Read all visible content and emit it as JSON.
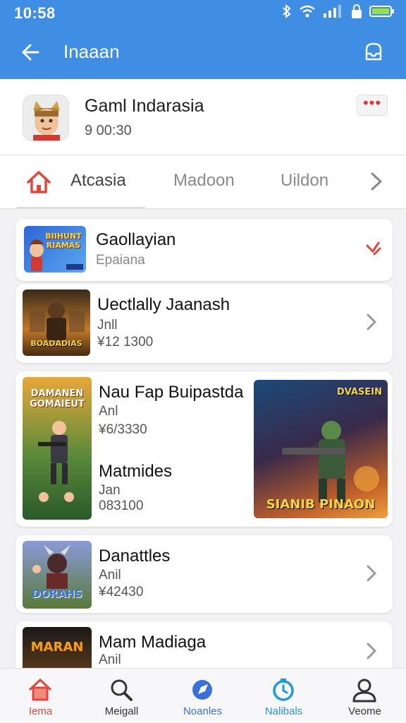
{
  "status": {
    "time": "10:58"
  },
  "header": {
    "title": "Inaaan"
  },
  "profile": {
    "name": "Gaml Indarasia",
    "subtitle": "9 00:30",
    "more": "•••"
  },
  "tabs": [
    {
      "label": "Atcasia"
    },
    {
      "label": "Madoon"
    },
    {
      "label": "Uildon"
    }
  ],
  "games": [
    {
      "title": "Gaollayian",
      "line1": "Epaiana",
      "thumb_text": "BIIHUNT RIAMAS"
    },
    {
      "title": "Uectlally Jaanash",
      "line1": "Jnll",
      "line2": "¥12 1300",
      "thumb_text": "BOADADIAS"
    },
    {
      "title": "Nau Fap Buipastda",
      "line1": "Anl",
      "line2": "¥6/3330",
      "title2": "Matmides",
      "line3": "Jan",
      "line4": "083100",
      "thumb_text": "DAMANEN GOMAIEUT",
      "thumb_text2": "DVASEIN",
      "thumb_caption": "SIANIB PINAON"
    },
    {
      "title": "Danattles",
      "line1": "Anil",
      "line2": "¥42430",
      "thumb_text": "DORAHS"
    },
    {
      "title": "Mam Madiaga",
      "line1": "Anil",
      "thumb_text": "MARAN"
    }
  ],
  "nav": [
    {
      "label": "Iema",
      "color": "#e0463a"
    },
    {
      "label": "Meigall",
      "color": "#333333"
    },
    {
      "label": "Noanles",
      "color": "#3b6fd8"
    },
    {
      "label": "Nalibals",
      "color": "#1e9ad6"
    },
    {
      "label": "Veome",
      "color": "#333333"
    }
  ]
}
